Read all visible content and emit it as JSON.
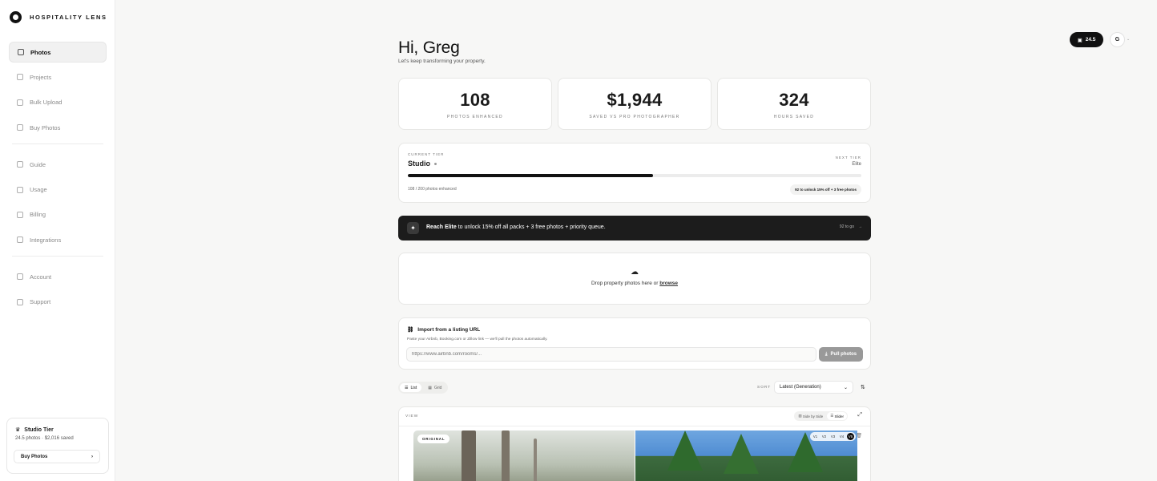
{
  "brand": {
    "name": "HOSPITALITY LENS"
  },
  "nav": {
    "group1": [
      {
        "id": "photos",
        "label": "Photos",
        "active": true,
        "icon": "image-icon"
      },
      {
        "id": "projects",
        "label": "Projects",
        "icon": "folder-icon"
      },
      {
        "id": "bulk-upload",
        "label": "Bulk Upload",
        "icon": "upload-icon"
      },
      {
        "id": "buy-photos",
        "label": "Buy Photos",
        "icon": "sparkle-icon"
      }
    ],
    "group2": [
      {
        "id": "guide",
        "label": "Guide",
        "icon": "book-icon"
      },
      {
        "id": "usage",
        "label": "Usage",
        "icon": "chart-icon"
      },
      {
        "id": "billing",
        "label": "Billing",
        "icon": "card-icon"
      },
      {
        "id": "integrations",
        "label": "Integrations",
        "icon": "plug-icon"
      }
    ],
    "group3": [
      {
        "id": "account",
        "label": "Account",
        "icon": "user-icon"
      },
      {
        "id": "support",
        "label": "Support",
        "icon": "lifebuoy-icon"
      }
    ]
  },
  "sidebar_tier": {
    "title": "Studio Tier",
    "detail": "24.5 photos · $2,016 saved",
    "buy_label": "Buy Photos",
    "chevron": "›"
  },
  "header": {
    "credits": "24.5",
    "avatar_initial": "G",
    "chevron": "⌄"
  },
  "greeting": {
    "title": "Hi, Greg",
    "subtitle": "Let's keep transforming your property."
  },
  "stats": [
    {
      "value": "108",
      "label": "PHOTOS ENHANCED"
    },
    {
      "value": "$1,944",
      "label": "SAVED VS PRO PHOTOGRAPHER"
    },
    {
      "value": "324",
      "label": "HOURS SAVED"
    }
  ],
  "tier": {
    "current_label": "CURRENT TIER",
    "current": "Studio",
    "next_label": "NEXT TIER",
    "next": "Elite",
    "progress": 0.54,
    "count_text": "108 / 200 photos enhanced",
    "chip": "92 to unlock 15% off + 3 free photos"
  },
  "promo": {
    "text_prefix": "Reach ",
    "text_bold": "Elite",
    "text_suffix": " to unlock 15% off all packs + 3 free photos + priority queue.",
    "togo": "92 to go",
    "arrow": "→"
  },
  "dropzone": {
    "text": "Drop property photos here or ",
    "link": "browse"
  },
  "import": {
    "title": "Import from a listing URL",
    "description": "Paste your Airbnb, Booking.com or Zillow link — we'll pull the photos automatically.",
    "placeholder": "https://www.airbnb.com/rooms/...",
    "button": "Pull photos"
  },
  "list_controls": {
    "view_list": "List",
    "view_grid": "Grid",
    "sort_label": "SORT",
    "sort_value": "Latest (Generation)"
  },
  "viewer": {
    "label": "VIEW",
    "mode_side": "Side by Side",
    "mode_slider": "Slider",
    "original_badge": "ORIGINAL",
    "versions": [
      "V1",
      "V2",
      "V3",
      "V4",
      "V5"
    ],
    "active_version": "V5"
  }
}
